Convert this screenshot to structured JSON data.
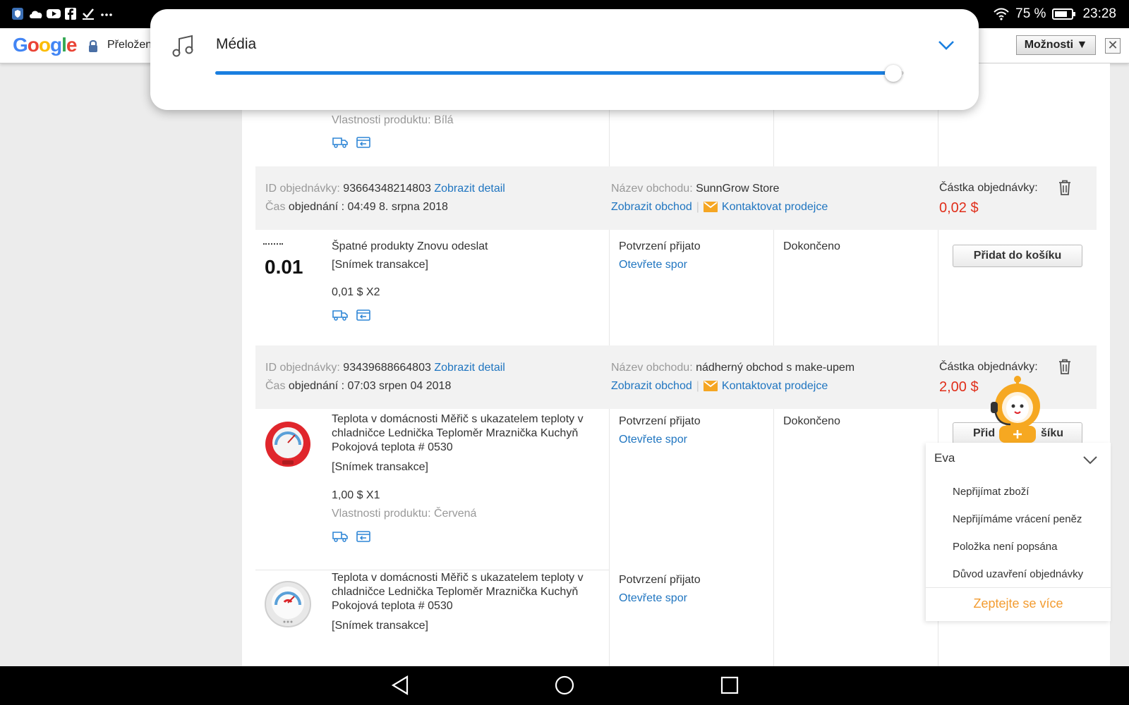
{
  "status_bar": {
    "battery": "75 %",
    "time": "23:28"
  },
  "translate_bar": {
    "logo": "Google",
    "translated_label": "Přeložen",
    "options_label": "Možnosti ▼",
    "close_label": "✕"
  },
  "media_panel": {
    "title": "Média",
    "volume_fraction": 0.985
  },
  "top_fragment": {
    "properties": "Vlastnosti produktu: Bílá"
  },
  "orders": [
    {
      "id_label": "ID objednávky:",
      "id": "93664348214803",
      "detail_link": "Zobrazit detail",
      "time_label_1": "Čas",
      "time_label_2": "objednání :",
      "time": "04:49 8. srpna 2018",
      "store_label": "Název obchodu:",
      "store_name": "SunnGrow Store",
      "store_link": "Zobrazit obchod",
      "contact_link": "Kontaktovat prodejce",
      "amount_label": "Částka objednávky:",
      "amount": "0,02 $",
      "items": [
        {
          "thumb_text": "0.01",
          "title": "Špatné produkty Znovu odeslat",
          "snapshot": "[Snímek transakce]",
          "price_qty": "0,01 $ X2",
          "status": "Potvrzení přijato",
          "dispute_link": "Otevřete spor",
          "state": "Dokončeno",
          "cart_button": "Přidat do košíku"
        }
      ]
    },
    {
      "id_label": "ID objednávky:",
      "id": "93439688664803",
      "detail_link": "Zobrazit detail",
      "time_label_1": "Čas",
      "time_label_2": "objednání :",
      "time": "07:03 srpen 04 2018",
      "store_label": "Název obchodu:",
      "store_name": "nádherný obchod s make-upem",
      "store_link": "Zobrazit obchod",
      "contact_link": "Kontaktovat prodejce",
      "amount_label": "Částka objednávky:",
      "amount": "2,00 $",
      "items": [
        {
          "title_lines": [
            "Teplota v domácnosti Měřič s ukazatelem teploty v",
            "chladničce Lednička Teploměr Mraznička Kuchyň",
            "Pokojová teplota # 0530"
          ],
          "snapshot": "[Snímek transakce]",
          "price_qty": "1,00 $ X1",
          "properties": "Vlastnosti produktu: Červená",
          "status": "Potvrzení přijato",
          "dispute_link": "Otevřete spor",
          "state": "Dokončeno",
          "cart_button_left": "Přid",
          "cart_button_right": "šíku"
        },
        {
          "title_lines": [
            "Teplota v domácnosti Měřič s ukazatelem teploty v",
            "chladničce Lednička Teploměr Mraznička Kuchyň",
            "Pokojová teplota # 0530"
          ],
          "snapshot": "[Snímek transakce]",
          "status": "Potvrzení přijato",
          "dispute_link": "Otevřete spor"
        }
      ]
    }
  ],
  "eva": {
    "name": "Eva",
    "options": [
      "Nepřijímat zboží",
      "Nepřijímáme vrácení peněz",
      "Položka není popsána",
      "Důvod uzavření objednávky"
    ],
    "ask_more": "Zeptejte se více"
  },
  "colors": {
    "link_blue": "#1f75c0",
    "price_red": "#e02e1a",
    "accent_orange": "#f39c31",
    "slider_blue": "#1a7fe0"
  }
}
